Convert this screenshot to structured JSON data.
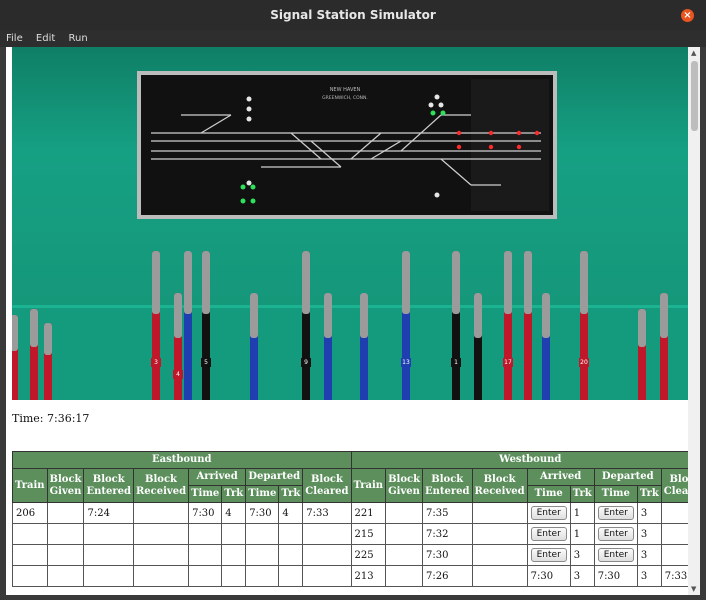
{
  "window": {
    "title": "Signal Station Simulator",
    "close_symbol": "×"
  },
  "menu": [
    "File",
    "Edit",
    "Run"
  ],
  "board_text": {
    "header": "NEW HAVEN",
    "sub": "GREENWICH, CONN."
  },
  "lever_tags": [
    "3",
    "4",
    "5",
    "9",
    "13",
    "1",
    "17",
    "20"
  ],
  "status": {
    "time_label": "Time:",
    "time_value": "7:36:17"
  },
  "table": {
    "eastbound": "Eastbound",
    "westbound": "Westbound",
    "cols": {
      "train": "Train",
      "block_given": [
        "Block",
        "Given"
      ],
      "block_entered": [
        "Block",
        "Entered"
      ],
      "block_received": [
        "Block",
        "Received"
      ],
      "arrived": "Arrived",
      "departed": "Departed",
      "block_cleared": [
        "Block",
        "Cleared"
      ],
      "time": "Time",
      "trk": "Trk"
    },
    "enter_label": "Enter",
    "rows": [
      {
        "e": {
          "train": "206",
          "given": "",
          "entered": "7:24",
          "received": "",
          "arr_time": "7:30",
          "arr_trk": "4",
          "dep_time": "7:30",
          "dep_trk": "4",
          "cleared": "7:33"
        },
        "w": {
          "train": "221",
          "given": "",
          "entered": "7:35",
          "received": "",
          "arr_time": "Enter",
          "arr_trk": "1",
          "dep_time": "Enter",
          "dep_trk": "3",
          "cleared": ""
        }
      },
      {
        "e": {
          "train": "",
          "given": "",
          "entered": "",
          "received": "",
          "arr_time": "",
          "arr_trk": "",
          "dep_time": "",
          "dep_trk": "",
          "cleared": ""
        },
        "w": {
          "train": "215",
          "given": "",
          "entered": "7:32",
          "received": "",
          "arr_time": "Enter",
          "arr_trk": "1",
          "dep_time": "Enter",
          "dep_trk": "3",
          "cleared": ""
        }
      },
      {
        "e": {
          "train": "",
          "given": "",
          "entered": "",
          "received": "",
          "arr_time": "",
          "arr_trk": "",
          "dep_time": "",
          "dep_trk": "",
          "cleared": ""
        },
        "w": {
          "train": "225",
          "given": "",
          "entered": "7:30",
          "received": "",
          "arr_time": "Enter",
          "arr_trk": "3",
          "dep_time": "Enter",
          "dep_trk": "3",
          "cleared": ""
        }
      },
      {
        "e": {
          "train": "",
          "given": "",
          "entered": "",
          "received": "",
          "arr_time": "",
          "arr_trk": "",
          "dep_time": "",
          "dep_trk": "",
          "cleared": ""
        },
        "w": {
          "train": "213",
          "given": "",
          "entered": "7:26",
          "received": "",
          "arr_time": "7:30",
          "arr_trk": "3",
          "dep_time": "7:30",
          "dep_trk": "3",
          "cleared": "7:33"
        }
      }
    ]
  },
  "colors": {
    "wall": "#16a083",
    "header": "#5c8f5c",
    "lever_red": "#c0182a",
    "lever_blue": "#1f3fb0",
    "lever_black": "#111111"
  }
}
